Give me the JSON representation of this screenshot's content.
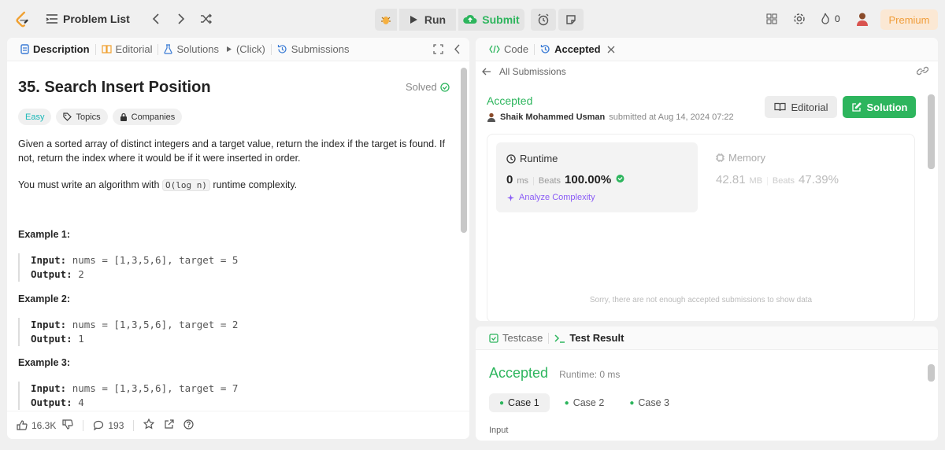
{
  "topbar": {
    "problem_list": "Problem List",
    "run": "Run",
    "submit": "Submit",
    "streak": "0",
    "premium": "Premium"
  },
  "left": {
    "tabs": [
      "Description",
      "Editorial",
      "Solutions",
      "(Click)",
      "Submissions"
    ],
    "title": "35. Search Insert Position",
    "solved": "Solved",
    "chips": [
      "Easy",
      "Topics",
      "Companies"
    ],
    "para1": "Given a sorted array of distinct integers and a target value, return the index if the target is found. If not, return the index where it would be if it were inserted in order.",
    "para2_pre": "You must write an algorithm with ",
    "para2_code": "O(log n)",
    "para2_post": " runtime complexity.",
    "examples": [
      {
        "heading": "Example 1:",
        "input_label": "Input:",
        "input": "nums = [1,3,5,6], target = 5",
        "output_label": "Output:",
        "output": "2"
      },
      {
        "heading": "Example 2:",
        "input_label": "Input:",
        "input": "nums = [1,3,5,6], target = 2",
        "output_label": "Output:",
        "output": "1"
      },
      {
        "heading": "Example 3:",
        "input_label": "Input:",
        "input": "nums = [1,3,5,6], target = 7",
        "output_label": "Output:",
        "output": "4"
      }
    ],
    "likes": "16.3K",
    "comments": "193"
  },
  "right_top": {
    "tabs": [
      "Code",
      "Accepted"
    ],
    "back": "All Submissions",
    "status": "Accepted",
    "author": "Shaik Mohammed Usman",
    "submitted": "submitted at Aug 14, 2024 07:22",
    "editorial_btn": "Editorial",
    "solution_btn": "Solution",
    "runtime_label": "Runtime",
    "runtime_value": "0",
    "runtime_unit": "ms",
    "beats_label": "Beats",
    "runtime_beats": "100.00%",
    "analyze": "Analyze Complexity",
    "memory_label": "Memory",
    "memory_value": "42.81",
    "memory_unit": "MB",
    "memory_beats": "47.39%",
    "sorry": "Sorry, there are not enough accepted submissions to show data"
  },
  "right_bottom": {
    "tabs": [
      "Testcase",
      "Test Result"
    ],
    "status": "Accepted",
    "runtime": "Runtime: 0 ms",
    "cases": [
      "Case 1",
      "Case 2",
      "Case 3"
    ],
    "input_label": "Input"
  }
}
